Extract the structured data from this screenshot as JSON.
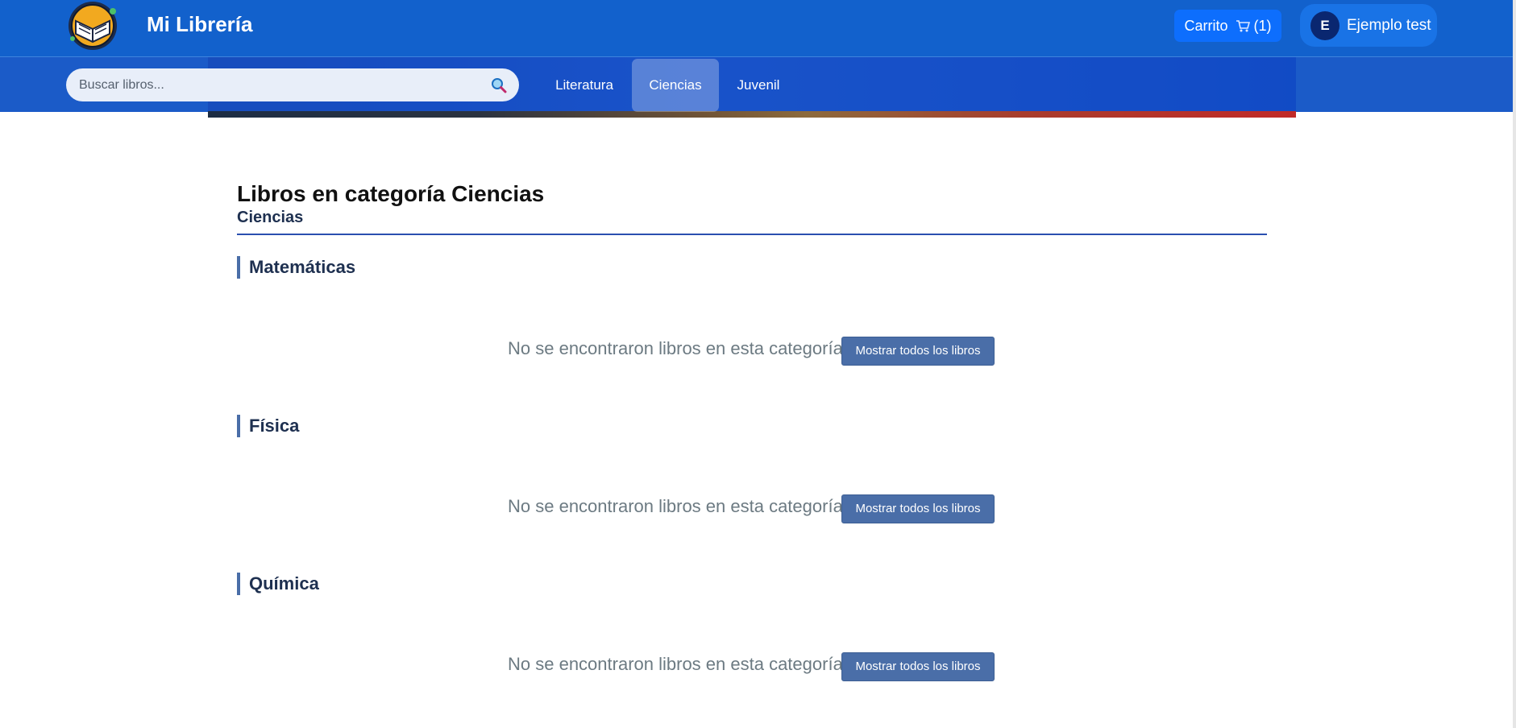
{
  "header": {
    "brand": "Mi Librería",
    "cart": {
      "label": "Carrito",
      "icon": "cart-icon",
      "count_text": "(1)"
    },
    "user": {
      "initial": "E",
      "name": "Ejemplo test"
    }
  },
  "nav": {
    "search": {
      "placeholder": "Buscar libros...",
      "value": "",
      "icon": "search-icon"
    },
    "items": [
      {
        "label": "Literatura",
        "active": false
      },
      {
        "label": "Ciencias",
        "active": true
      },
      {
        "label": "Juvenil",
        "active": false
      }
    ]
  },
  "main": {
    "title": "Libros en categoría Ciencias",
    "subtitle": "Ciencias",
    "sections": [
      {
        "heading": "Matemáticas",
        "empty_text": "No se encontraron libros en esta categoría",
        "button": "Mostrar todos los libros"
      },
      {
        "heading": "Física",
        "empty_text": "No se encontraron libros en esta categoría",
        "button": "Mostrar todos los libros"
      },
      {
        "heading": "Química",
        "empty_text": "No se encontraron libros en esta categoría",
        "button": "Mostrar todos los libros"
      }
    ]
  },
  "colors": {
    "header_bg": "#1261cc",
    "nav_bg": "#1b5bc8",
    "cart_button": "#0d6efd",
    "accent": "#4a6ea8",
    "heading_text": "#1e3050",
    "muted_text": "#6c7a82"
  }
}
